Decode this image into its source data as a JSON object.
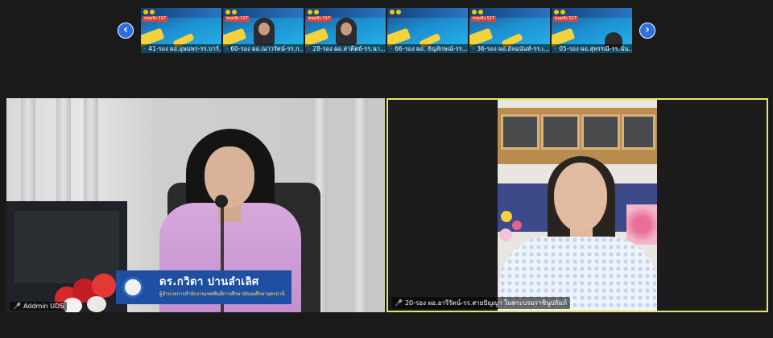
{
  "gallery": {
    "thumbnails": [
      {
        "name": "41-รอง ผอ.อุษมพร-รร.บาร์...",
        "has_person": false
      },
      {
        "name": "60-รอง ผอ.ณาวรัตน์-รร.ก...",
        "has_person": true
      },
      {
        "name": "28-รอง ผอ.สาคิตย์-รร.นา...",
        "has_person": true
      },
      {
        "name": "66-รอง ผอ. ธัญลักษณ์-รร....",
        "has_person": false
      },
      {
        "name": "36-รอง ผอ.อัจฉนันท์-รร.เ...",
        "has_person": false
      },
      {
        "name": "05-รอง ผอ.สุพรรณี-รร.นั่น...",
        "has_person": true
      }
    ],
    "prev_icon": "‹",
    "next_icon": "›",
    "thumb_tag": "ขนมปัง 117"
  },
  "speaker_left": {
    "label": "Addmin UDS",
    "nameplate_name": "ดร.กวิตา ปานลำเลิศ",
    "nameplate_title": "ผู้อำนวยการสำนักงานเขตพื้นที่การศึกษามัธยมศึกษาอุดรธานี"
  },
  "speaker_right": {
    "label": "20-รอง ผอ.อารีรัตน์-รร.สายปัญญา ในพระบรมราชินูปถัมภ์"
  },
  "colors": {
    "background": "#1a1a1a",
    "active_speaker_border": "#e6e66a",
    "nav_button": "#2f6fe0"
  }
}
